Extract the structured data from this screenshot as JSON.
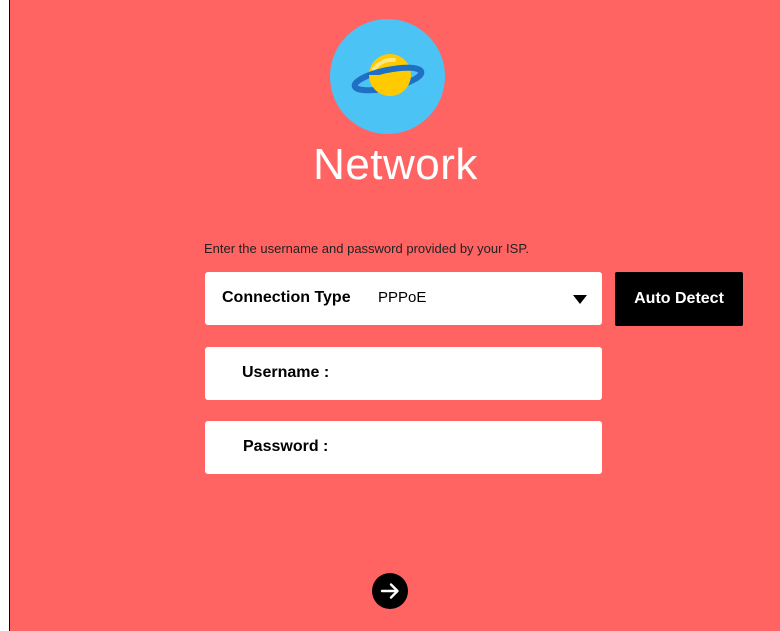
{
  "title": "Network",
  "instruction": "Enter the username and password provided by your ISP.",
  "connection": {
    "label": "Connection Type",
    "value": "PPPoE"
  },
  "auto_detect_label": "Auto Detect",
  "username": {
    "label": "Username :",
    "value": ""
  },
  "password": {
    "label": "Password :",
    "value": ""
  },
  "icons": {
    "logo": "planet-icon",
    "dropdown": "caret-down-icon",
    "next": "arrow-right-icon"
  },
  "colors": {
    "background": "#ff6362",
    "logo_circle": "#4cc3f5",
    "planet": "#ffcb00",
    "ring": "#1f6fc4",
    "button": "#000000"
  }
}
